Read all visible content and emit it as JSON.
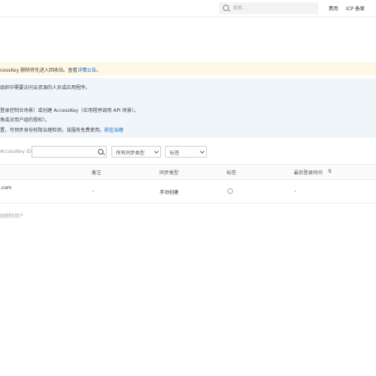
{
  "topbar": {
    "search_placeholder": "搜索...",
    "links": [
      "费用",
      "ICP 备案"
    ]
  },
  "notice": {
    "prefix": "cessKey 删除将先进入回收站。查看",
    "link": "详情公告",
    "suffix": "。"
  },
  "tips": {
    "lines": [
      "组织中需要访问云资源的人员或应用程序。",
      "登录控制台场景）或创建 AccessKey（应用程序调用 API 场景）。",
      "角或对用户组的授权）。",
      "置，可预步身份权限治理检测，该服务免费使用。"
    ],
    "last_link": "前往治理"
  },
  "filters": {
    "search_placeholder": "AccessKey ID",
    "sync_type_select": "所有同步类型",
    "tag_select": "标签"
  },
  "table": {
    "headers": [
      "备注",
      "同步类型",
      "标签",
      "最后登录时间"
    ],
    "rows": [
      {
        "user": ".com",
        "remark": "-",
        "sync": "手动创建",
        "last_login": "-"
      }
    ]
  },
  "footer": {
    "note": "级删除用户"
  }
}
